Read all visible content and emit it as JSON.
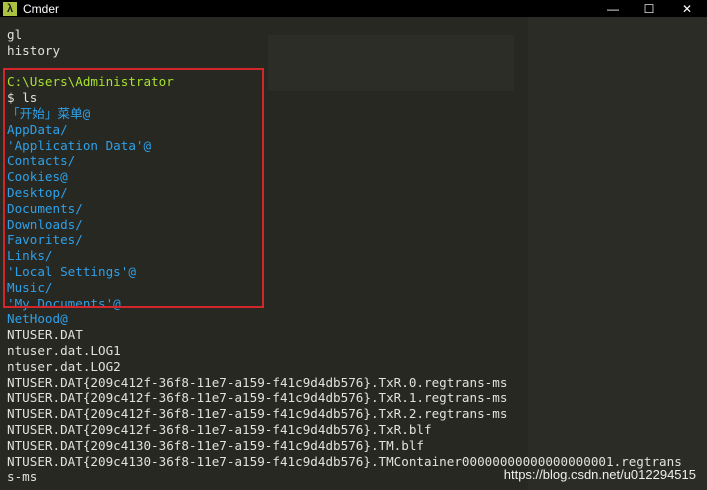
{
  "window": {
    "title": "Cmder",
    "icon": "lambda-icon",
    "icon_glyph": "λ",
    "buttons": [
      "—",
      "☐",
      "✕"
    ]
  },
  "terminal": {
    "lines": [
      {
        "text": "gl",
        "color": "white"
      },
      {
        "text": "history",
        "color": "white"
      },
      {
        "text": "",
        "color": "white"
      },
      {
        "text": "C:\\Users\\Administrator",
        "color": "path"
      },
      {
        "text": "$ ls",
        "color": "white"
      },
      {
        "text": "「开始」菜单@",
        "color": "dir"
      },
      {
        "text": "AppData/",
        "color": "dir"
      },
      {
        "text": "'Application Data'@",
        "color": "dir"
      },
      {
        "text": "Contacts/",
        "color": "dir"
      },
      {
        "text": "Cookies@",
        "color": "dir"
      },
      {
        "text": "Desktop/",
        "color": "dir"
      },
      {
        "text": "Documents/",
        "color": "dir"
      },
      {
        "text": "Downloads/",
        "color": "dir"
      },
      {
        "text": "Favorites/",
        "color": "dir"
      },
      {
        "text": "Links/",
        "color": "dir"
      },
      {
        "text": "'Local Settings'@",
        "color": "dir"
      },
      {
        "text": "Music/",
        "color": "dir"
      },
      {
        "text": "'My Documents'@",
        "color": "dir"
      },
      {
        "text": "NetHood@",
        "color": "dir"
      },
      {
        "text": "NTUSER.DAT",
        "color": "white"
      },
      {
        "text": "ntuser.dat.LOG1",
        "color": "white"
      },
      {
        "text": "ntuser.dat.LOG2",
        "color": "white"
      },
      {
        "text": "NTUSER.DAT{209c412f-36f8-11e7-a159-f41c9d4db576}.TxR.0.regtrans-ms",
        "color": "white"
      },
      {
        "text": "NTUSER.DAT{209c412f-36f8-11e7-a159-f41c9d4db576}.TxR.1.regtrans-ms",
        "color": "white"
      },
      {
        "text": "NTUSER.DAT{209c412f-36f8-11e7-a159-f41c9d4db576}.TxR.2.regtrans-ms",
        "color": "white"
      },
      {
        "text": "NTUSER.DAT{209c412f-36f8-11e7-a159-f41c9d4db576}.TxR.blf",
        "color": "white"
      },
      {
        "text": "NTUSER.DAT{209c4130-36f8-11e7-a159-f41c9d4db576}.TM.blf",
        "color": "white"
      },
      {
        "text": "NTUSER.DAT{209c4130-36f8-11e7-a159-f41c9d4db576}.TMContainer00000000000000000001.regtrans",
        "color": "white"
      },
      {
        "text": "s-ms",
        "color": "white"
      }
    ]
  },
  "watermark": "https://blog.csdn.net/u012294515",
  "colors": {
    "path": "#a6e22e",
    "dir": "#2fa0e8",
    "white": "#e2e2dc",
    "highlight": "#d3262c",
    "background": "#272822"
  }
}
